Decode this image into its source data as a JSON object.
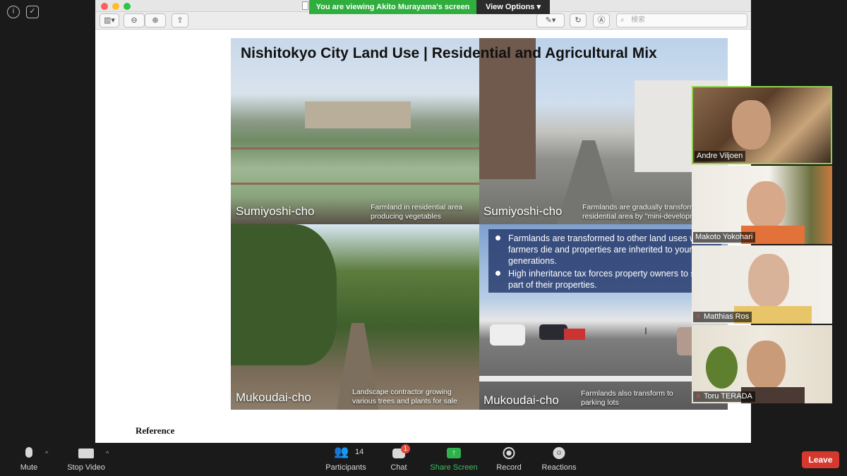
{
  "window": {
    "viewing_banner": "You are viewing Akito Murayama's screen",
    "view_options": "View Options"
  },
  "toolbar": {
    "search_placeholder": "検索"
  },
  "slide": {
    "title": "Nishitokyo City Land Use | Residential and Agricultural Mix",
    "panels": [
      {
        "place": "Sumiyoshi-cho",
        "caption": "Farmland in residential area producing vegetables"
      },
      {
        "place": "Sumiyoshi-cho",
        "caption": "Farmlands are gradually transformed to residential area by \"mini-developments\""
      },
      {
        "place": "Mukoudai-cho",
        "caption": "Landscape contractor growing various trees and plants for sale"
      },
      {
        "place": "Mukoudai-cho",
        "caption": "Farmlands also transform to parking lots"
      }
    ],
    "bullets": [
      "Farmlands are transformed to other land uses when farmers die and properties are inherited to younger generations.",
      "High inheritance tax forces property owners to sell a part of their properties."
    ]
  },
  "document": {
    "reference_heading": "Reference"
  },
  "participants": [
    {
      "name": "Andre Viljoen",
      "muted": false,
      "active": true
    },
    {
      "name": "Makoto Yokohari",
      "muted": false,
      "active": false
    },
    {
      "name": "Matthias Ros",
      "muted": true,
      "active": false
    },
    {
      "name": "Toru TERADA",
      "muted": true,
      "active": false
    }
  ],
  "controls": {
    "mute": "Mute",
    "stop_video": "Stop Video",
    "participants": "Participants",
    "participants_count": "14",
    "chat": "Chat",
    "chat_badge": "1",
    "share_screen": "Share Screen",
    "record": "Record",
    "reactions": "Reactions",
    "leave": "Leave"
  },
  "colors": {
    "banner_green": "#2fae3e",
    "leave_red": "#d5392e",
    "active_speaker": "#8fd14f"
  }
}
